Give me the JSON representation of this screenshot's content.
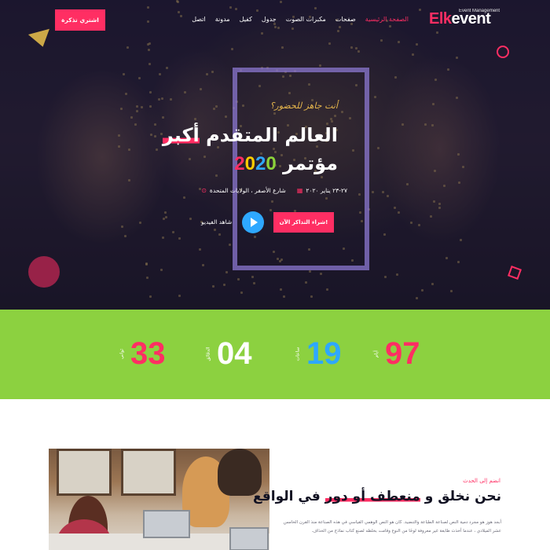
{
  "header": {
    "logo": {
      "part1": "Elk",
      "part2": "event",
      "tagline": "Event Management"
    },
    "nav": [
      {
        "label": "الصفحة الرئيسية",
        "active": true
      },
      {
        "label": "صفحات",
        "active": false
      },
      {
        "label": "مكبرات الصوت",
        "active": false
      },
      {
        "label": "جدول",
        "active": false
      },
      {
        "label": "كفيل",
        "active": false
      },
      {
        "label": "مدونة",
        "active": false
      },
      {
        "label": "اتصل",
        "active": false
      }
    ],
    "cta_label": "اشتري تذكرة"
  },
  "hero": {
    "ready_text": "أنت جاهز للحضور؟",
    "headline_line1_before": "العالم المتقدم ",
    "headline_line1_highlight": "أكبر",
    "headline_line2": "مؤتمر",
    "year_digits": [
      "2",
      "0",
      "2",
      "0"
    ],
    "location": "شارع الأصفر ، الولايات المتحدة",
    "date": "٢٧-٢٣ يناير ٢٠٢٠",
    "primary_button": "شراء التذاكر الآن!",
    "watch_label": "شاهد الفيديو",
    "icons": {
      "location": "map-pin-icon",
      "date": "calendar-icon",
      "play": "play-icon"
    }
  },
  "countdown": {
    "items": [
      {
        "value": "97",
        "label": "أيام",
        "color": "#ff2e63"
      },
      {
        "value": "19",
        "label": "ساعات",
        "color": "#2ea8ff"
      },
      {
        "value": "04",
        "label": "الدقائق",
        "color": "#ffffff"
      },
      {
        "value": "33",
        "label": "ثواني",
        "color": "#ff2e63"
      }
    ]
  },
  "about": {
    "tag": "انضم إلى الحدث",
    "title_before": "نحن نخلق و ",
    "title_highlight": "منعطف أو دور",
    "title_after": " في الواقع",
    "body": "أبجد هوز هو مجرد دمية النص لصناعة الطباعة والتنضيد. كان هو النص الوهمي القياسي في هذه الصناعة منذ القرن الخامس عشر الميلادي ، عندما أخذت طابعة غير معروفة لوحًا من النوع وقامت بخلطه لصنع كتاب نماذج من الحذاف."
  },
  "colors": {
    "accent": "#ff2e63",
    "blue": "#2ea8ff",
    "yellow": "#ffcc00",
    "green": "#8cd140",
    "gold": "#e6b64c"
  }
}
